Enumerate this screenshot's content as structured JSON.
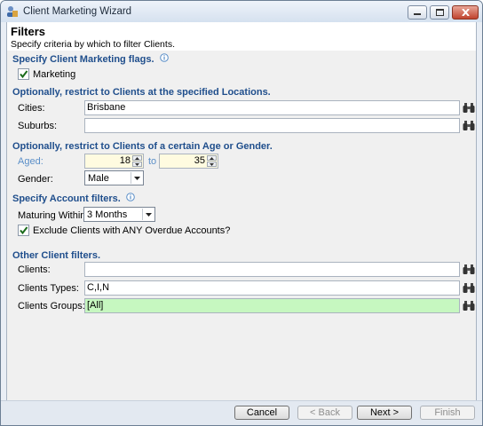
{
  "window": {
    "title": "Client Marketing Wizard"
  },
  "header": {
    "title": "Filters",
    "subtitle": "Specify criteria by which to filter Clients."
  },
  "flags": {
    "heading": "Specify Client Marketing flags.",
    "marketing_label": "Marketing",
    "marketing_checked": true
  },
  "locations": {
    "heading": "Optionally, restrict to Clients at the specified Locations.",
    "cities_label": "Cities:",
    "cities_value": "Brisbane",
    "suburbs_label": "Suburbs:",
    "suburbs_value": ""
  },
  "age_gender": {
    "heading": "Optionally, restrict to Clients of a certain Age or Gender.",
    "aged_label": "Aged:",
    "age_from": "18",
    "to_label": "to",
    "age_to": "35",
    "gender_label": "Gender:",
    "gender_value": "Male"
  },
  "account": {
    "heading": "Specify Account filters.",
    "maturing_label": "Maturing Within:",
    "maturing_value": "3 Months",
    "exclude_label": "Exclude Clients with ANY Overdue Accounts?",
    "exclude_checked": true
  },
  "other": {
    "heading": "Other Client filters.",
    "clients_label": "Clients:",
    "clients_value": "",
    "types_label": "Clients Types:",
    "types_value": "C,I,N",
    "groups_label": "Clients Groups:",
    "groups_value": "[All]"
  },
  "footer": {
    "cancel": "Cancel",
    "back": "< Back",
    "next": "Next >",
    "finish": "Finish"
  },
  "colors": {
    "heading": "#1f4e8c",
    "aged_label": "#5b8fc8",
    "groups_bg": "#c6f7c0",
    "spin_bg": "#fffbe0"
  },
  "icons": {
    "app": "wizard-app-icon",
    "info": "info-icon",
    "finder": "binoculars-icon"
  }
}
